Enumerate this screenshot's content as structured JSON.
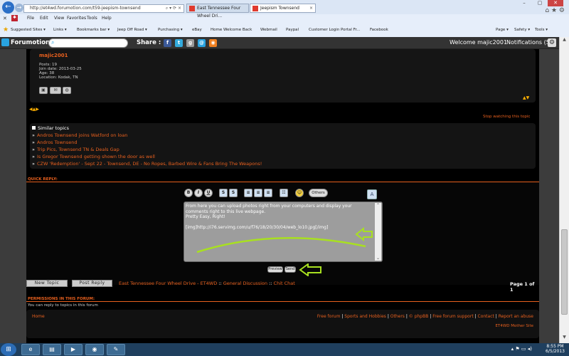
{
  "browser": {
    "address": "http://et4wd.forumotion.com/t59-jeepism-townsend",
    "tabs": [
      {
        "label": "East Tennessee Four Wheel Dri..."
      },
      {
        "label": "Jeepism Townsend"
      }
    ],
    "menu": [
      "File",
      "Edit",
      "View",
      "Favorites",
      "Tools",
      "Help"
    ],
    "favorites": [
      "Suggested Sites ▾",
      "Links ▾",
      "Bookmarks bar ▾",
      "Jeep Off Road ▾",
      "Purchasing ▾",
      "eBay",
      "Home Welcome Back",
      "Webmail",
      "Paypal",
      "Customer Login Portal Fr...",
      "Facebook"
    ],
    "command_bar": [
      "Page ▾",
      "Safety ▾",
      "Tools ▾"
    ]
  },
  "forumotion_bar": {
    "logo": "Forumotion",
    "share_label": "Share :",
    "share_icons": [
      "f",
      "t",
      "g",
      "@",
      "rss"
    ],
    "welcome": "Welcome majic2001",
    "notifications": "Notifications (5)"
  },
  "profile": {
    "username": "majic2001",
    "stats": [
      "Posts: 19",
      "Join date: 2013-03-25",
      "Age: 38",
      "Location: Kodak, TN"
    ]
  },
  "stop_watching": "Stop watching this topic",
  "similar_topics": {
    "heading": "Similar topics",
    "items": [
      "Andros Townsend joins Watford on loan",
      "Andros Townsend",
      "Trip Pics, Townsend TN & Deals Gap",
      "Is Gregor Townsend getting shown the door as well",
      "CZW 'Redemption' - Sept 22 - Townsend, DE - No Ropes, Barbed Wire & Fans Bring The Weapons!"
    ]
  },
  "quick_reply": {
    "label": "QUICK REPLY:",
    "toolbar": [
      "B",
      "I",
      "U",
      "S",
      "S",
      "≡",
      "≡",
      "≡",
      "☷",
      "☺",
      "Others"
    ],
    "message": "From here you can upload photos right from your computers and display your\ncomments right to this live webpage.\nPretty Easy, Right!\n\n[img]http://i76.servimg.com/u/f76/18/20/30/04/web_lo10.jpg[/img]",
    "preview": "Preview",
    "send": "Send"
  },
  "actions": {
    "new_topic": "New Topic",
    "post_reply": "Post Reply"
  },
  "breadcrumb": {
    "site": "East Tennessee Four Wheel Drive - ET4WD",
    "sep1": " :: ",
    "category": "General Discussion",
    "sep2": " :: ",
    "forum": "Chit Chat"
  },
  "page_info": "Page 1 of 1",
  "permissions": {
    "label": "PERMISSIONS IN THIS FORUM:",
    "text": "You can reply to topics in this forum"
  },
  "footer": {
    "home": "Home",
    "links": [
      "Free forum",
      "Sports and Hobbies",
      "Others",
      "© phpBB",
      "Free forum support",
      "Contact",
      "Report an abuse"
    ],
    "mother_site": "ET4WD Mother Site"
  },
  "taskbar": {
    "time": "8:55 PM",
    "date": "6/5/2013"
  },
  "colors": {
    "accent": "#e8601e",
    "annotation": "#a8e020"
  }
}
